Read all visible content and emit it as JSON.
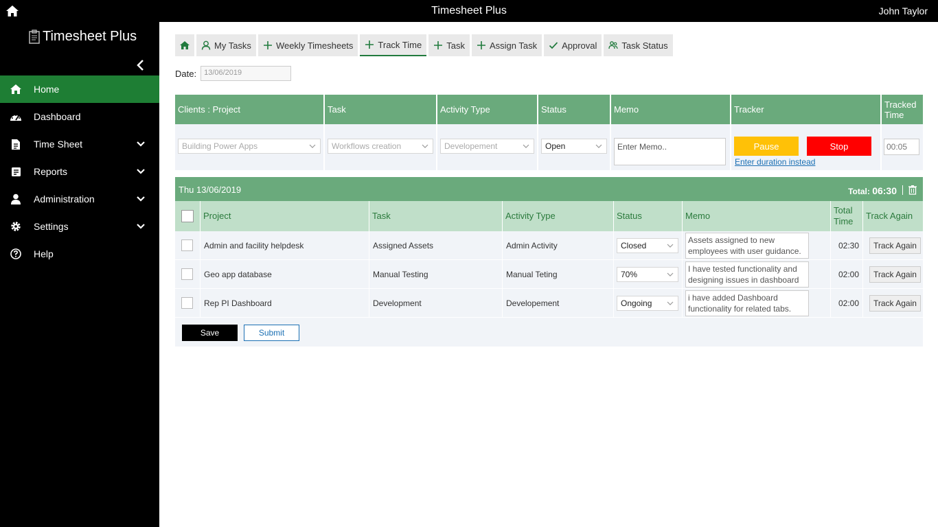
{
  "app": {
    "title": "Timesheet Plus",
    "user": "John Taylor"
  },
  "sidebar": {
    "brand": "Timesheet Plus",
    "items": [
      {
        "label": "Home",
        "icon": "home-icon",
        "active": true,
        "expandable": false
      },
      {
        "label": "Dashboard",
        "icon": "dashboard-icon",
        "active": false,
        "expandable": false
      },
      {
        "label": "Time Sheet",
        "icon": "document-icon",
        "active": false,
        "expandable": true
      },
      {
        "label": "Reports",
        "icon": "report-icon",
        "active": false,
        "expandable": true
      },
      {
        "label": "Administration",
        "icon": "user-icon",
        "active": false,
        "expandable": true
      },
      {
        "label": "Settings",
        "icon": "gear-icon",
        "active": false,
        "expandable": true
      },
      {
        "label": "Help",
        "icon": "help-icon",
        "active": false,
        "expandable": false
      }
    ]
  },
  "tabs": [
    {
      "label": "",
      "icon": "home-icon"
    },
    {
      "label": "My Tasks",
      "icon": "user-icon"
    },
    {
      "label": "Weekly Timesheets",
      "icon": "plus-icon"
    },
    {
      "label": "Track Time",
      "icon": "plus-icon",
      "active": true
    },
    {
      "label": "Task",
      "icon": "plus-icon"
    },
    {
      "label": "Assign Task",
      "icon": "plus-icon"
    },
    {
      "label": "Approval",
      "icon": "check-icon"
    },
    {
      "label": "Task Status",
      "icon": "users-icon"
    }
  ],
  "date": {
    "label": "Date:",
    "value": "13/06/2019"
  },
  "tracker": {
    "headers": [
      "Clients : Project",
      "Task",
      "Activity Type",
      "Status",
      "Memo",
      "Tracker",
      "Tracked Time"
    ],
    "project": "Building Power Apps",
    "task": "Workflows creation",
    "activity": "Developement",
    "status": "Open",
    "memo_placeholder": "Enter Memo..",
    "pause_label": "Pause",
    "stop_label": "Stop",
    "enter_duration": "Enter duration instead",
    "tracked_time": "00:05"
  },
  "day": {
    "title": "Thu 13/06/2019",
    "total_label": "Total:",
    "total_value": "06:30",
    "headers": [
      "Project",
      "Task",
      "Activity Type",
      "Status",
      "Memo",
      "Total Time",
      "Track Again"
    ],
    "rows": [
      {
        "project": "Admin and facility helpdesk",
        "task": "Assigned Assets",
        "activity": "Admin Activity",
        "status": "Closed",
        "memo": "Assets assigned to new employees with user guidance.",
        "total": "02:30",
        "action": "Track Again"
      },
      {
        "project": "Geo app database",
        "task": "Manual Testing",
        "activity": "Manual Teting",
        "status": "70%",
        "memo": "I have tested functionality and designing issues in dashboard",
        "total": "02:00",
        "action": "Track Again"
      },
      {
        "project": "Rep PI Dashboard",
        "task": "Development",
        "activity": "Developement",
        "status": "Ongoing",
        "memo": "i have added Dashboard functionality for related tabs.",
        "total": "02:00",
        "action": "Track Again"
      }
    ],
    "save_label": "Save",
    "submit_label": "Submit"
  },
  "colors": {
    "accent": "#1e7e34",
    "header_green": "#6aaa7c",
    "light_green": "#c0dfc9",
    "pause": "#ffc107",
    "stop": "#ff0000"
  }
}
